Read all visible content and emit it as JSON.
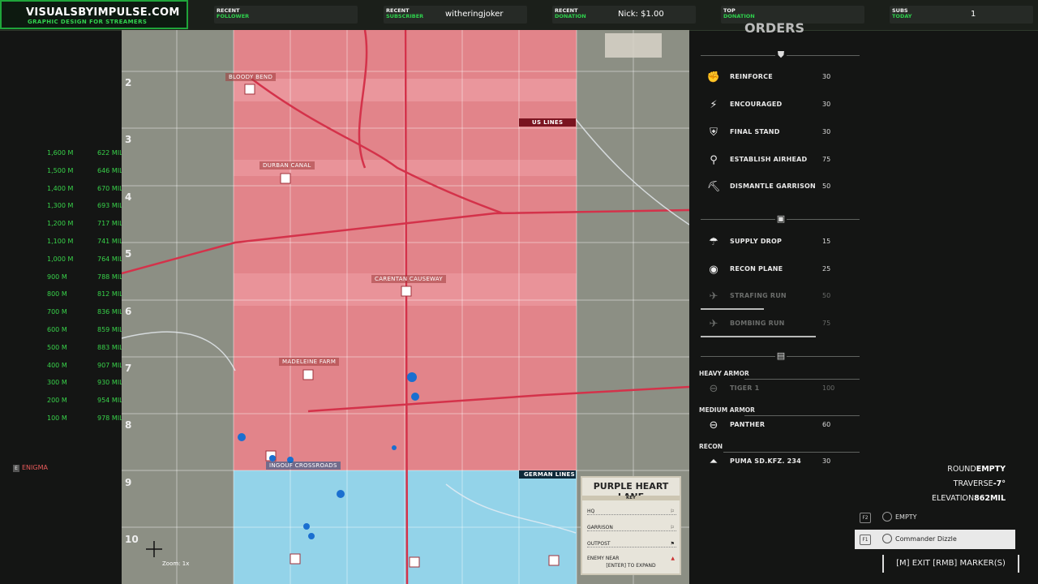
{
  "banner": {
    "brand_title": "VISUALSBYIMPULSE.COM",
    "brand_subtitle": "GRAPHIC DESIGN FOR STREAMERS",
    "slots": [
      {
        "l1": "RECENT",
        "l2": "FOLLOWER",
        "value": ""
      },
      {
        "l1": "RECENT",
        "l2": "SUBSCRIBER",
        "value": "witheringjoker"
      },
      {
        "l1": "RECENT",
        "l2": "DONATION",
        "value": "Nick: $1.00"
      },
      {
        "l1": "TOP",
        "l2": "DONATION",
        "value": ""
      },
      {
        "l1": "SUBS",
        "l2": "TODAY",
        "value": "1"
      }
    ]
  },
  "map": {
    "rows": [
      "2",
      "3",
      "4",
      "5",
      "6",
      "7",
      "8",
      "9",
      "10"
    ],
    "labels": {
      "bloody_bend": "BLOODY BEND",
      "durban_canal": "DURBAN CANAL",
      "carentan_causeway": "CARENTAN CAUSEWAY",
      "madeleine_farm": "MADELEINE FARM",
      "ingouf_crossroads": "INGOUF CROSSROADS",
      "us_lines": "US LINES",
      "german_lines": "GERMAN LINES",
      "zoom": "Zoom: 1x"
    },
    "key": {
      "title": "PURPLE HEART LANE",
      "subtitle": "KEY",
      "rows": [
        "HQ",
        "GARRISON",
        "OUTPOST",
        "ENEMY NEAR"
      ],
      "expand_hint": "[ENTER] TO EXPAND"
    }
  },
  "ranges": [
    {
      "dist": "1,600 M",
      "mil": "622 MIL"
    },
    {
      "dist": "1,500 M",
      "mil": "646 MIL"
    },
    {
      "dist": "1,400 M",
      "mil": "670 MIL"
    },
    {
      "dist": "1,300 M",
      "mil": "693 MIL"
    },
    {
      "dist": "1,200 M",
      "mil": "717 MIL"
    },
    {
      "dist": "1,100 M",
      "mil": "741 MIL"
    },
    {
      "dist": "1,000 M",
      "mil": "764 MIL"
    },
    {
      "dist": "900 M",
      "mil": "788 MIL"
    },
    {
      "dist": "800 M",
      "mil": "812 MIL"
    },
    {
      "dist": "700 M",
      "mil": "836 MIL"
    },
    {
      "dist": "600 M",
      "mil": "859 MIL"
    },
    {
      "dist": "500 M",
      "mil": "883 MIL"
    },
    {
      "dist": "400 M",
      "mil": "907 MIL"
    },
    {
      "dist": "300 M",
      "mil": "930 MIL"
    },
    {
      "dist": "200 M",
      "mil": "954 MIL"
    },
    {
      "dist": "100 M",
      "mil": "978 MIL"
    }
  ],
  "squad_tag": "ENIGMA",
  "orders": {
    "title": "ORDERS",
    "group1": [
      {
        "name": "REINFORCE",
        "cost": "30",
        "icon": "fist-icon"
      },
      {
        "name": "ENCOURAGED",
        "cost": "30",
        "icon": "bolt-icon"
      },
      {
        "name": "FINAL STAND",
        "cost": "30",
        "icon": "shield-icon"
      },
      {
        "name": "ESTABLISH AIRHEAD",
        "cost": "75",
        "icon": "parachute-icon"
      },
      {
        "name": "DISMANTLE GARRISON",
        "cost": "50",
        "icon": "pickaxe-icon"
      }
    ],
    "group2": [
      {
        "name": "SUPPLY DROP",
        "cost": "15",
        "icon": "supply-parachute-icon"
      },
      {
        "name": "RECON PLANE",
        "cost": "25",
        "icon": "recon-plane-icon"
      },
      {
        "name": "STRAFING RUN",
        "cost": "50",
        "icon": "strafing-icon"
      },
      {
        "name": "BOMBING RUN",
        "cost": "75",
        "icon": "bomb-icon"
      }
    ],
    "heavy_armor_label": "HEAVY ARMOR",
    "heavy": {
      "name": "TIGER 1",
      "cost": "100"
    },
    "medium_armor_label": "MEDIUM ARMOR",
    "medium": {
      "name": "PANTHER",
      "cost": "60"
    },
    "recon_label": "RECON",
    "recon": {
      "name": "PUMA SD.KFZ. 234",
      "cost": "30"
    }
  },
  "stats": {
    "round_label": "ROUND",
    "round_value": "EMPTY",
    "traverse_label": "TRAVERSE",
    "traverse_value": "-7°",
    "elevation_label": "ELEVATION",
    "elevation_value": "862MIL"
  },
  "commanders": [
    {
      "key": "F2",
      "name": "EMPTY"
    },
    {
      "key": "F1",
      "name": "Commander Dizzle"
    }
  ],
  "exit_hint": "[M] EXIT  [RMB] MARKER(S)",
  "colors": {
    "green": "#2fd04d",
    "us_zone": "#e8727d",
    "german_zone": "#8fd0e8"
  }
}
